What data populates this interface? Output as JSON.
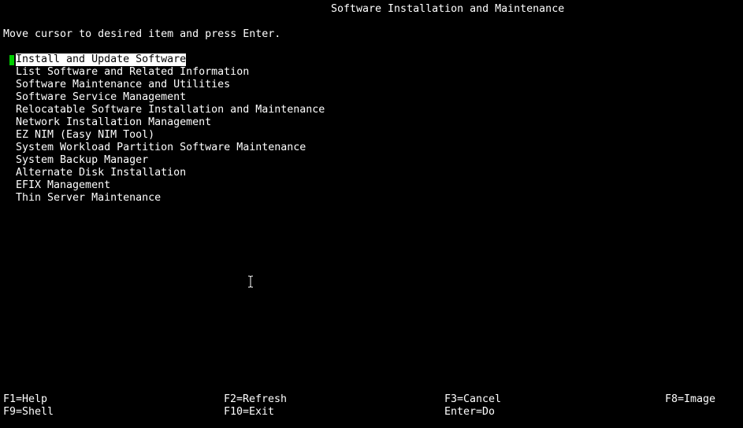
{
  "header": {
    "title": "Software Installation and Maintenance",
    "instruction": "Move cursor to desired item and press Enter."
  },
  "menu": {
    "items": [
      {
        "label": "Install and Update Software",
        "selected": true
      },
      {
        "label": "List Software and Related Information"
      },
      {
        "label": "Software Maintenance and Utilities"
      },
      {
        "label": "Software Service Management"
      },
      {
        "label": "Relocatable Software Installation and Maintenance"
      },
      {
        "label": "Network Installation Management"
      },
      {
        "label": "EZ NIM (Easy NIM Tool)"
      },
      {
        "label": "System Workload Partition Software Maintenance"
      },
      {
        "label": "System Backup Manager"
      },
      {
        "label": "Alternate Disk Installation"
      },
      {
        "label": "EFIX Management"
      },
      {
        "label": "Thin Server Maintenance"
      }
    ]
  },
  "footer": {
    "keys": [
      {
        "label": "F1=Help"
      },
      {
        "label": "F2=Refresh"
      },
      {
        "label": "F3=Cancel"
      },
      {
        "label": "F8=Image"
      },
      {
        "label": "F9=Shell"
      },
      {
        "label": "F10=Exit"
      },
      {
        "label": "Enter=Do"
      }
    ]
  },
  "colors": {
    "background": "#000000",
    "text": "#ffffff",
    "cursor": "#00cc00",
    "selection_bg": "#ffffff"
  },
  "icons": {
    "mouse_cursor": "text-ibeam-icon"
  }
}
